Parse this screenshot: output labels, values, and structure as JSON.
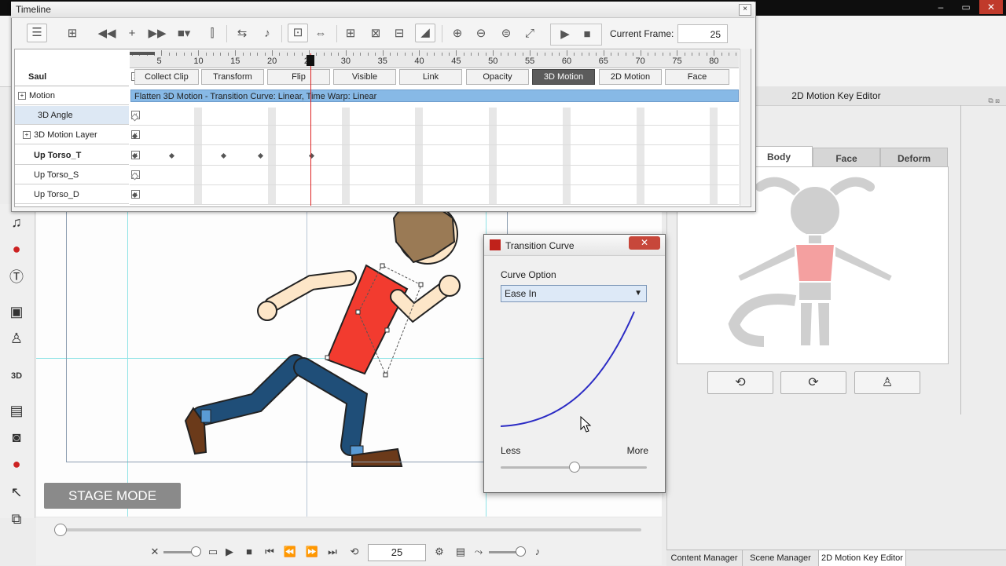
{
  "timeline": {
    "title": "Timeline",
    "close": "×",
    "current_frame_label": "Current Frame:",
    "current_frame_value": "25",
    "ruler_ticks": [
      "5",
      "10",
      "15",
      "20",
      "25",
      "30",
      "35",
      "40",
      "45",
      "50",
      "55",
      "60",
      "65",
      "70",
      "75",
      "80"
    ],
    "actor": "Saul",
    "channels": [
      "Collect Clip",
      "Transform",
      "Flip",
      "Visible",
      "Link",
      "Opacity",
      "3D Motion",
      "2D Motion",
      "Face"
    ],
    "active_channel": "3D Motion",
    "tracks": [
      {
        "label": "Motion"
      },
      {
        "label": "3D Angle"
      },
      {
        "label": "3D Motion Layer"
      },
      {
        "label": "Up Torso_T"
      },
      {
        "label": "Up Torso_S"
      },
      {
        "label": "Up Torso_D"
      }
    ],
    "motion_clip_text": "Flatten 3D Motion - Transition Curve: Linear, Time Warp: Linear",
    "x_mark": "x",
    "plus_mark": "+"
  },
  "stage": {
    "mode_label": "STAGE MODE",
    "frame_value": "25"
  },
  "transition_curve": {
    "title": "Transition Curve",
    "close": "✕",
    "curve_option_label": "Curve Option",
    "selected_option": "Ease In",
    "slider_left": "Less",
    "slider_right": "More",
    "slider_fraction": 0.5,
    "curve_color": "#2b2bc4"
  },
  "right_panel": {
    "title": "2D Motion Key Editor",
    "tabs": [
      "Body",
      "Face",
      "Deform"
    ],
    "active_tab": "Body",
    "highlight_color": "#f4a0a0"
  },
  "bottom_tabs": [
    "Content Manager",
    "Scene Manager",
    "2D Motion Key Editor"
  ],
  "active_bottom_tab": "2D Motion Key Editor",
  "window_controls": [
    "–",
    "▭",
    "✕"
  ]
}
